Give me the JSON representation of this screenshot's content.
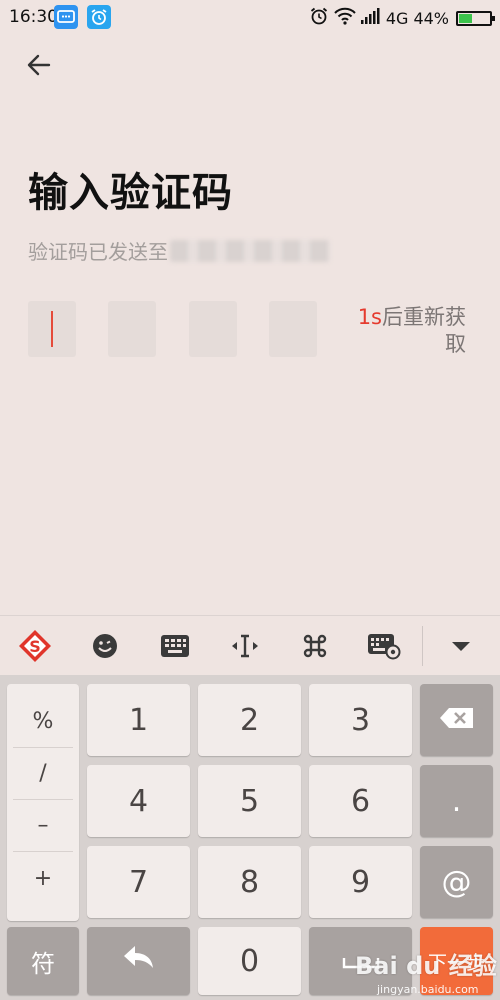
{
  "status_bar": {
    "time": "16:30",
    "network": "4G",
    "battery": "44%",
    "battery_level": 0.44,
    "icons": [
      "message-icon",
      "alarm-app-icon",
      "alarm-clock-icon",
      "wifi-icon",
      "signal-icon",
      "battery-icon"
    ]
  },
  "header": {
    "back_icon": "arrow-left-icon",
    "title": "输入验证码",
    "subtitle_prefix": "验证码已发送至",
    "subtitle_masked": "131 7"
  },
  "code_input": {
    "boxes": [
      "",
      "",
      "",
      ""
    ],
    "resend_count": "1s",
    "resend_text": "后重新获取"
  },
  "keyboard_toolbar": {
    "items": [
      "sogou-logo-icon",
      "emoji-icon",
      "keyboard-icon",
      "cursor-move-icon",
      "command-icon",
      "keyboard-settings-icon",
      "collapse-icon"
    ]
  },
  "keyboard": {
    "symbols": [
      "%",
      "/",
      "–",
      "+"
    ],
    "digits": [
      "1",
      "2",
      "3",
      "4",
      "5",
      "6",
      "7",
      "8",
      "9"
    ],
    "dot": ".",
    "at": "@",
    "zero": "0",
    "fu": "符",
    "next": "下一步",
    "accent_color": "#f26b3a"
  },
  "watermark": {
    "logo": "Bai du 经验",
    "url": "jingyan.baidu.com"
  }
}
